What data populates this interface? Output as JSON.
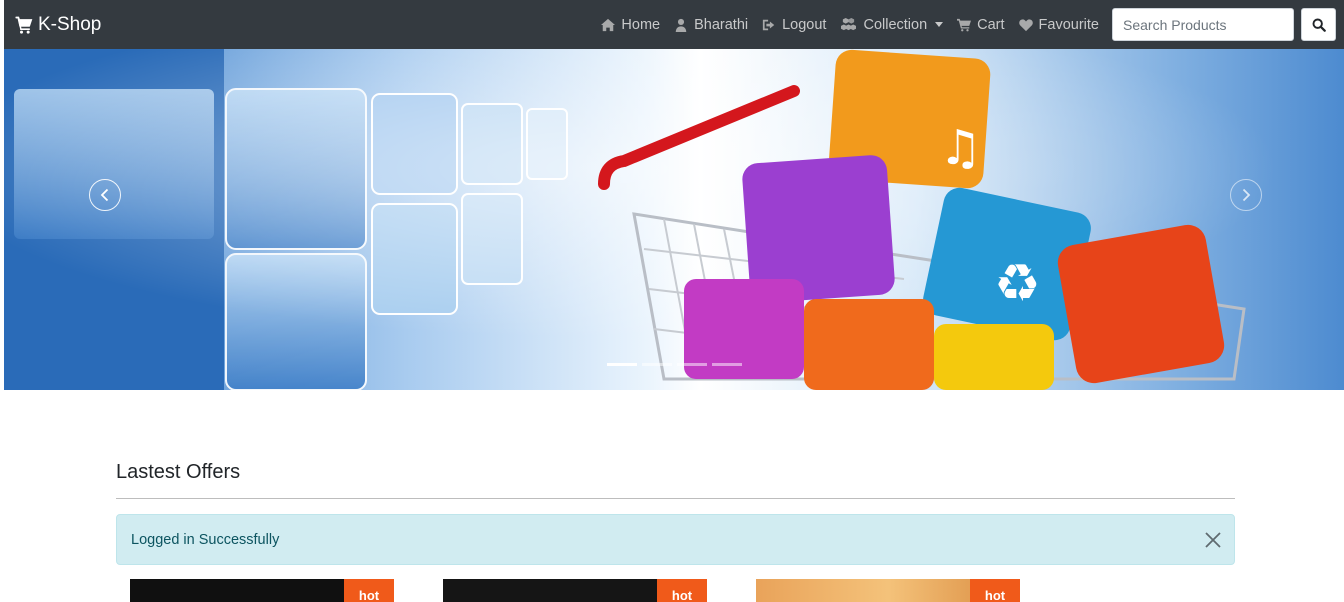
{
  "brand": {
    "name": "K-Shop",
    "icon": "cart-icon"
  },
  "nav": {
    "items": [
      {
        "label": "Home",
        "icon": "home-icon"
      },
      {
        "label": "Bharathi",
        "icon": "user-icon"
      },
      {
        "label": "Logout",
        "icon": "sign-out-icon"
      },
      {
        "label": "Collection",
        "icon": "cubes-icon",
        "dropdown": true
      },
      {
        "label": "Cart",
        "icon": "cart-icon"
      },
      {
        "label": "Favourite",
        "icon": "heart-icon"
      }
    ]
  },
  "search": {
    "placeholder": "Search Products",
    "value": "",
    "icon": "search-icon"
  },
  "carousel": {
    "slides": 4,
    "active_index": 0,
    "prev_icon": "chevron-left-icon",
    "next_icon": "chevron-right-icon"
  },
  "offers": {
    "title": "Lastest Offers",
    "alert": {
      "text": "Logged in Successfully",
      "close_icon": "close-icon"
    },
    "products": [
      {
        "badge": "hot"
      },
      {
        "badge": "hot"
      },
      {
        "badge": "hot"
      }
    ]
  },
  "colors": {
    "navbar": "#343a40",
    "alert_bg": "#d1ecf1",
    "alert_text": "#0c5460",
    "badge_hot": "#f05a1a"
  }
}
